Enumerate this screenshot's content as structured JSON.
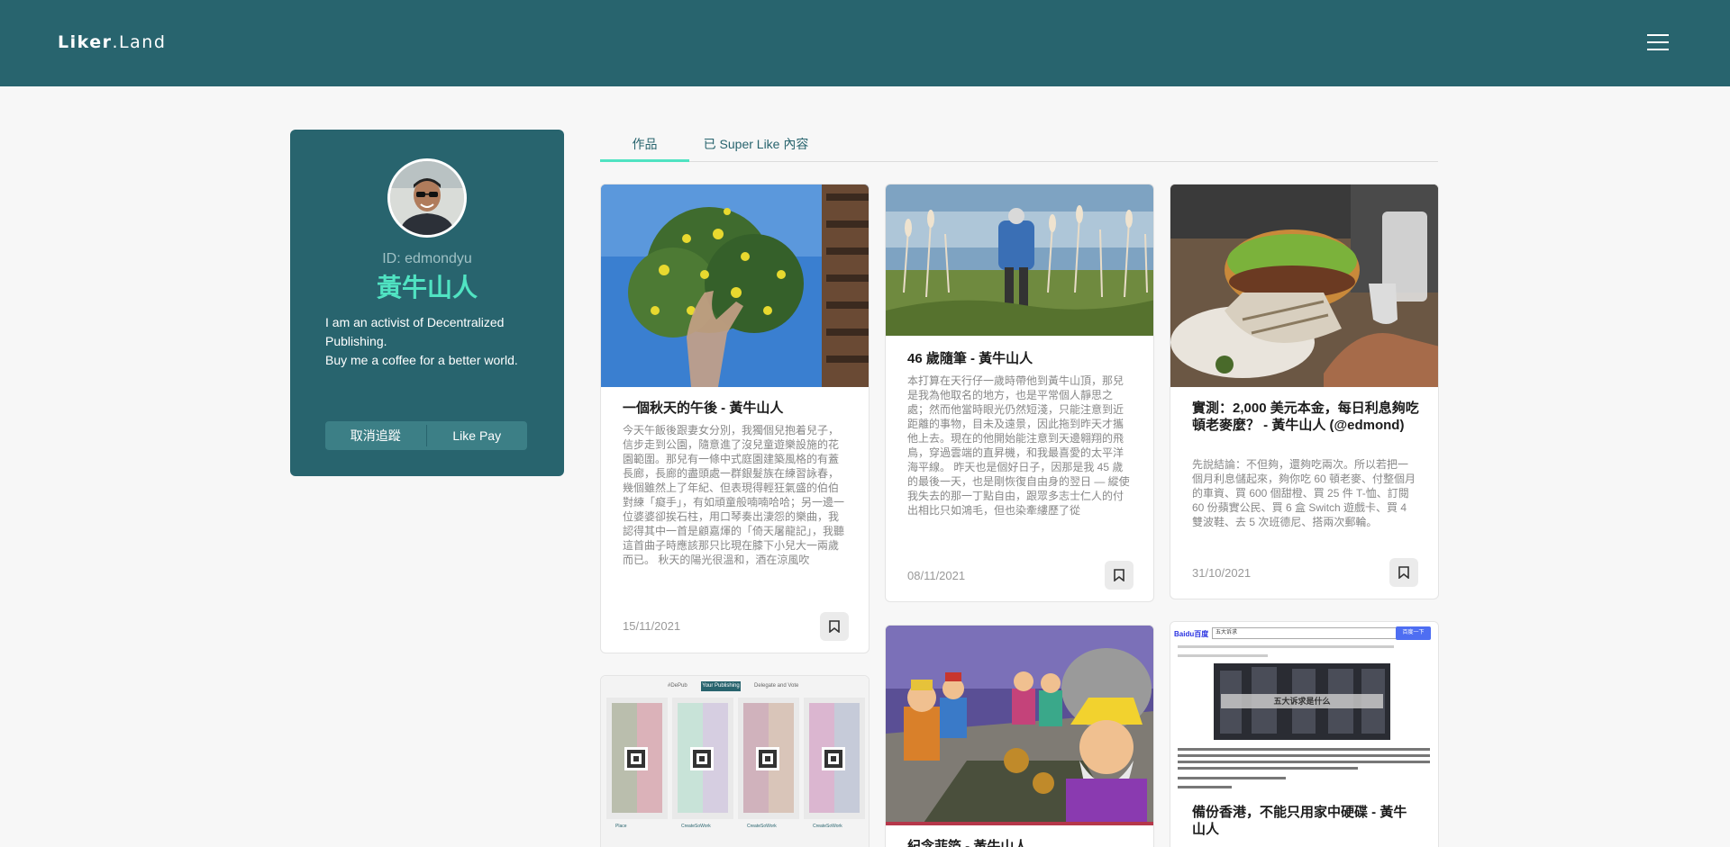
{
  "header": {
    "logo_main": "Liker",
    "logo_suffix": ".Land"
  },
  "profile": {
    "id_label": "ID: edmondyu",
    "name": "黃牛山人",
    "bio_line1": "I am an activist of Decentralized Publishing.",
    "bio_line2": "Buy me a coffee for a better world.",
    "unfollow_label": "取消追蹤",
    "likepay_label": "Like Pay"
  },
  "tabs": [
    {
      "label": "作品",
      "active": true
    },
    {
      "label": "已 Super Like 內容",
      "active": false
    }
  ],
  "cards": [
    {
      "title": "一個秋天的午後 - 黃牛山人",
      "excerpt": "今天午飯後跟妻女分別，我獨個兒抱着兒子，信步走到公園，隨意進了沒兒童遊樂設施的花園範圍。那兒有一條中式庭園建築風格的有蓋長廊，長廊的盡頭處一群銀髮族在練習詠春，幾個雖然上了年紀、但表現得輕狂氣盛的伯伯對練「癡手」，有如頑童般喃喃哈哈；另一邊一位婆婆卻挨石柱，用口琴奏出淒怨的樂曲，我認得其中一首是顧嘉煇的「倚天屠龍記」，我聽這首曲子時應該那只比現在膝下小兒大一兩歲而已。 秋天的陽光很溫和，酒在涼風吹",
      "date": "15/11/2021"
    },
    {
      "title": "46 歲隨筆 - 黃牛山人",
      "excerpt": "本打算在天行仔一歲時帶他到黃牛山頂，那兒是我為他取名的地方，也是平常個人靜思之處；然而他當時眼光仍然短淺，只能注意到近距離的事物，目未及遠景，因此拖到昨天才攜他上去。現在的他開始能注意到天邊翱翔的飛鳥，穿過雲端的直昇機，和我最喜愛的太平洋海平線。 昨天也是個好日子，因那是我 45 歲的最後一天，也是剛恢復自由身的翌日 — 縱使我失去的那一丁點自由，跟眾多志士仁人的付出相比只如鴻毛，但也染牽縷歷了從",
      "date": "08/11/2021"
    },
    {
      "title": "實測：2,000 美元本金，每日利息夠吃頓老麥麼？ - 黃牛山人 (@edmond)",
      "excerpt": "先說結論：不但夠，還夠吃兩次。所以若把一個月利息儲起來，夠你吃 60 頓老麥、付整個月的車資、買 600 個甜橙、買 25 件 T-恤、訂閱 60 份蘋實公民、買 6 盒 Switch 遊戲卡、買 4 雙波鞋、去 5 次班德尼、搭兩次郵輪。",
      "date": "31/10/2021"
    },
    {
      "title": "紀念菲箔 - 黃牛山人"
    },
    {
      "title": "備份香港，不能只用家中硬碟 - 黃牛山人"
    }
  ],
  "thumbnails": {
    "publish_tabs": [
      "#DePub",
      "Your Publishing",
      "Delegate and Vote"
    ],
    "publish_labels": [
      "Place",
      "CreateSoWork",
      "CreateSoWork",
      "CreateSoWork"
    ],
    "search_logo": "Baidu百度",
    "search_query": "五大诉求",
    "search_button": "百度一下",
    "search_overlay": "五大诉求是什么"
  },
  "colors": {
    "brand_dark": "#28646e",
    "accent": "#50e3c2",
    "button_bg": "#3c7f86"
  }
}
